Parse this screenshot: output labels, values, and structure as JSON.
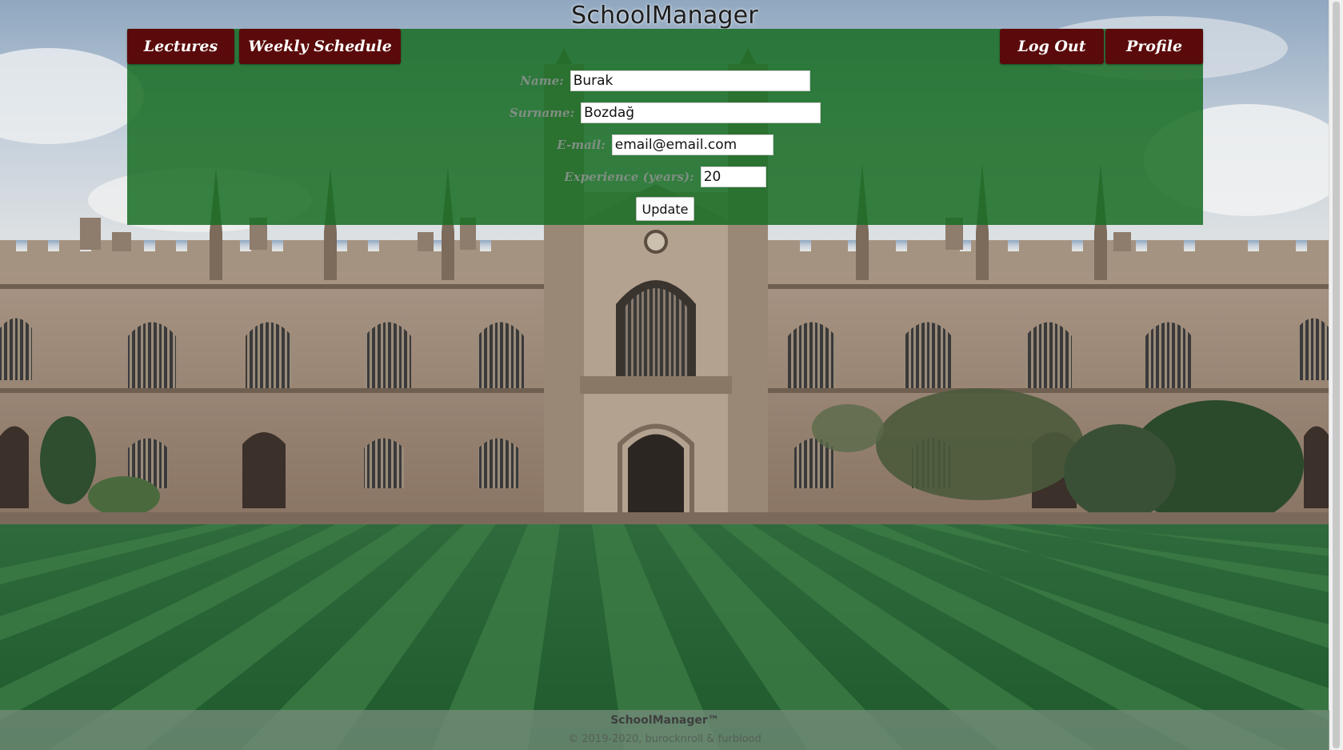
{
  "app": {
    "title": "SchoolManager"
  },
  "nav": {
    "lectures": "Lectures",
    "weekly_schedule": "Weekly Schedule",
    "log_out": "Log Out",
    "profile": "Profile"
  },
  "profile_form": {
    "name_label": "Name:",
    "name_value": "Burak",
    "surname_label": "Surname:",
    "surname_value": "Bozdağ",
    "email_label": "E-mail:",
    "email_value": "email@email.com",
    "experience_label": "Experience (years):",
    "experience_value": "20",
    "update_label": "Update"
  },
  "footer": {
    "brand": "SchoolManager™",
    "copyright": "© 2019-2020, burocknroll & furblood"
  },
  "colors": {
    "panel_green": "#186e24",
    "nav_button_maroon": "#5a0a0a",
    "footer_bg": "#738c7a"
  }
}
